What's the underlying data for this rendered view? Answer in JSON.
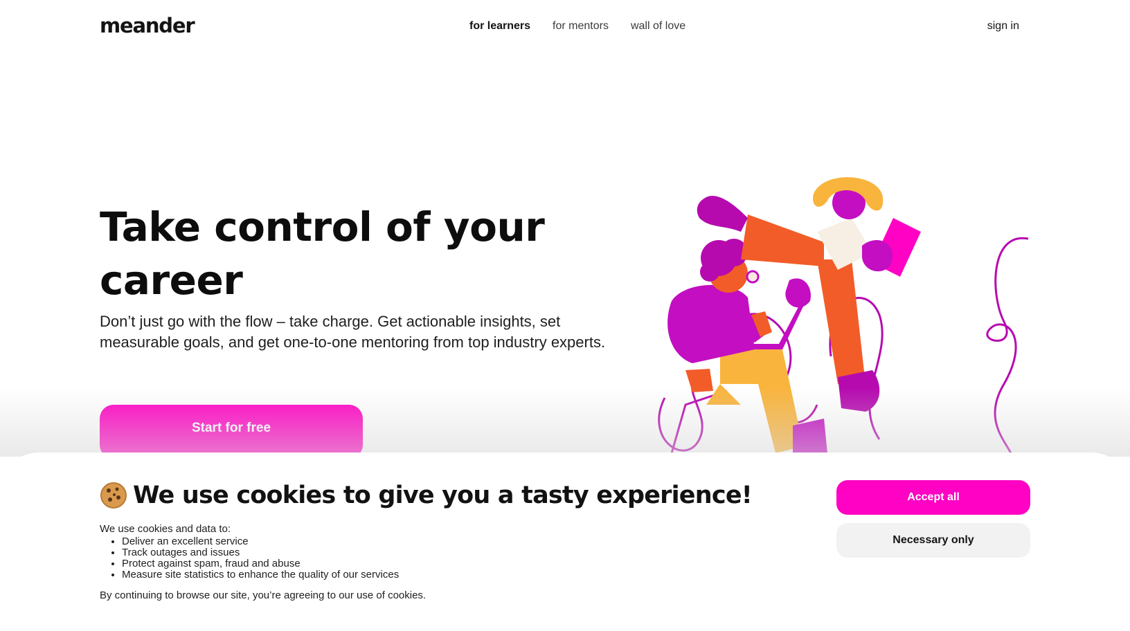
{
  "header": {
    "logo": "meander",
    "nav": [
      {
        "label": "for learners",
        "active": true
      },
      {
        "label": "for mentors",
        "active": false
      },
      {
        "label": "wall of love",
        "active": false
      }
    ],
    "sign_in": "sign in"
  },
  "hero": {
    "title": "Take control of your career",
    "description": "Don’t just go with the flow – take charge. Get actionable insights, set measurable goals, and get one-to-one mentoring from top industry experts.",
    "cta": "Start for free"
  },
  "cookie_banner": {
    "emoji_icon": "cookie-icon",
    "title": "We use cookies to give you a tasty experience!",
    "intro": "We use cookies and data to:",
    "items": [
      "Deliver an excellent service",
      "Track outages and issues",
      "Protect against spam, fraud and abuse",
      "Measure site statistics to enhance the quality of our services"
    ],
    "footer": "By continuing to browse our site, you’re agreeing to our use of cookies.",
    "accept_label": "Accept all",
    "necessary_label": "Necessary only"
  },
  "colors": {
    "accent": "#ff02c3",
    "orange": "#f25c28",
    "purple": "#c30ec2",
    "yellow": "#f9b43d"
  }
}
